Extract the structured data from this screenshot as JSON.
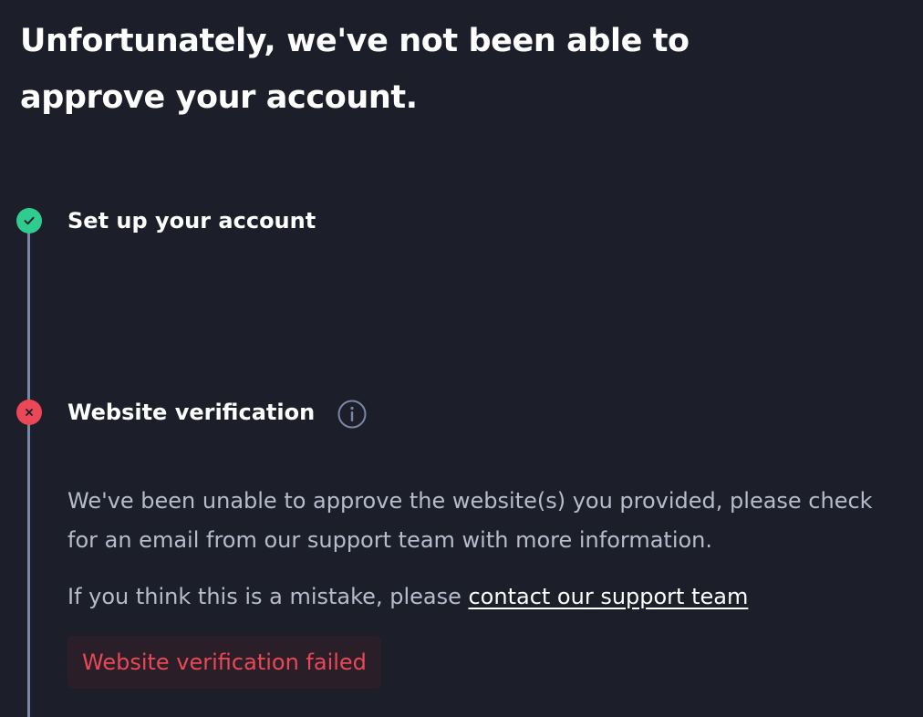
{
  "header": {
    "title": "Unfortunately, we've not been able to approve your account."
  },
  "steps": [
    {
      "title": "Set up your account",
      "status": "complete",
      "icon": "check-circle-icon",
      "color": "#2fcb8f"
    },
    {
      "title": "Website verification",
      "status": "failed",
      "icon": "x-circle-icon",
      "color": "#ea4856",
      "info_icon": "info-icon",
      "description": "We've been unable to approve the website(s) you provided, please check for an email from our support team with more information.",
      "mistake_text": "If you think this is a mistake, please ",
      "support_link": "contact our support team",
      "badge": "Website verification failed"
    }
  ],
  "colors": {
    "background": "#1c1f2a",
    "success": "#2fcb8f",
    "error": "#ea4856",
    "timeline": "#7a86a6",
    "muted_text": "#b7bccc"
  }
}
